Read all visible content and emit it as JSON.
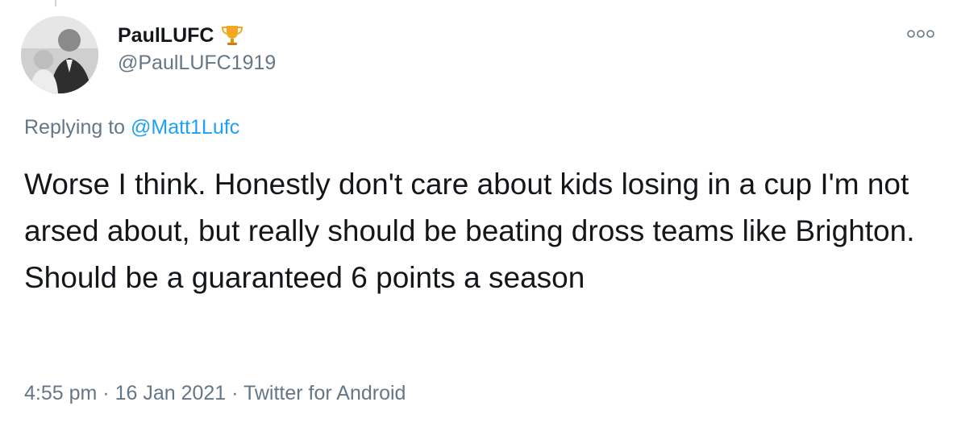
{
  "user": {
    "display_name": "PaulLUFC",
    "handle": "@PaulLUFC1919",
    "badge_icon": "trophy-icon"
  },
  "reply": {
    "prefix": "Replying to",
    "mention": "@Matt1Lufc"
  },
  "tweet": {
    "text": "Worse I think. Honestly don't care about kids losing in a cup I'm not arsed about, but really should be beating dross teams like Brighton. Should be a guaranteed 6 points a season"
  },
  "meta": {
    "time": "4:55 pm",
    "separator_1": "·",
    "date": "16 Jan 2021",
    "separator_2": "·",
    "source": "Twitter for Android"
  },
  "colors": {
    "text": "#14171a",
    "secondary": "#657786",
    "link": "#1da1f2",
    "trophy": "#f5a623"
  }
}
